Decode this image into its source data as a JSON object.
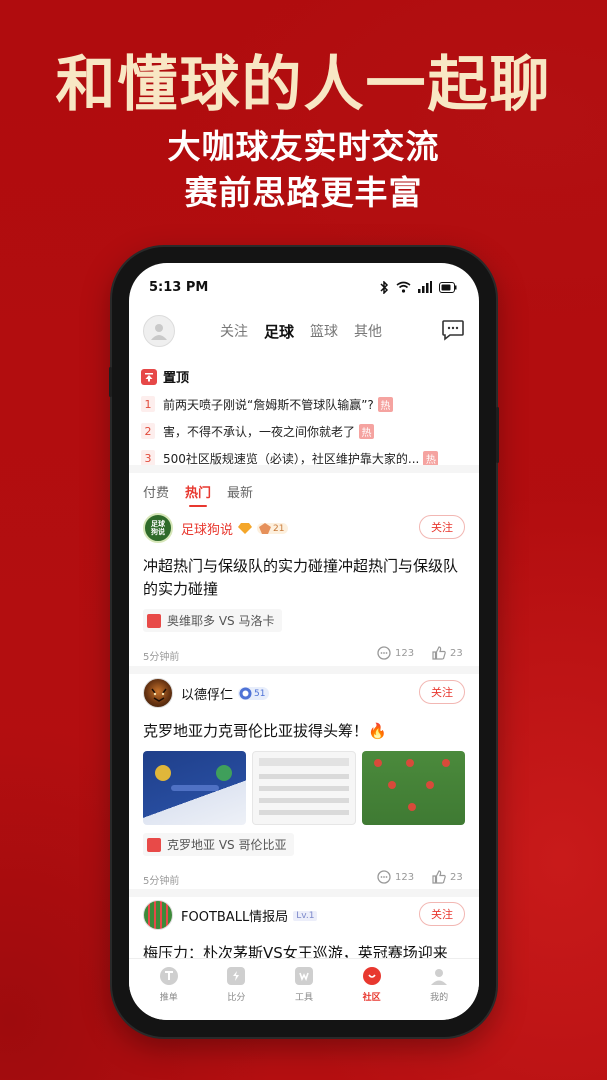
{
  "promo": {
    "headline": "和懂球的人一起聊",
    "line1": "大咖球友实时交流",
    "line2": "赛前思路更丰富"
  },
  "status": {
    "time": "5:13 PM"
  },
  "nav": {
    "tabs": [
      "关注",
      "足球",
      "篮球",
      "其他"
    ],
    "active": "足球"
  },
  "pinned": {
    "title": "置顶",
    "items": [
      {
        "num": "1",
        "text": "前两天喷子刚说“詹姆斯不管球队输赢”?",
        "tag": "热"
      },
      {
        "num": "2",
        "text": "害，不得不承认，一夜之间你就老了",
        "tag": "热"
      },
      {
        "num": "3",
        "text": "500社区版规速览（必读），社区维护靠大家的...",
        "tag": "热"
      }
    ]
  },
  "subtabs": [
    "付费",
    "热门",
    "最新"
  ],
  "posts": [
    {
      "avatar_text": "足球狗说",
      "user": "足球狗说",
      "level": "21",
      "follow": "关注",
      "text": "冲超热门与保级队的实力碰撞冲超热门与保级队的实力碰撞",
      "match": "奥维耶多 VS 马洛卡",
      "time": "5分钟前",
      "comments": "123",
      "likes": "23"
    },
    {
      "user": "以德俘仁",
      "level": "51",
      "follow": "关注",
      "text": "克罗地亚力克哥伦比亚拔得头筹！🔥",
      "match": "克罗地亚 VS 哥伦比亚",
      "time": "5分钟前",
      "comments": "123",
      "likes": "23"
    },
    {
      "user": "FOOTBALL情报局",
      "level": "Lv.1",
      "follow": "关注",
      "text": "梅压力：朴次茅斯VS女王巡游，英冠赛场迎来"
    }
  ],
  "bottom_nav": [
    {
      "label": "推单",
      "icon": "tuidan-icon"
    },
    {
      "label": "比分",
      "icon": "score-icon"
    },
    {
      "label": "工具",
      "icon": "tools-icon"
    },
    {
      "label": "社区",
      "icon": "community-icon",
      "active": true
    },
    {
      "label": "我的",
      "icon": "profile-icon"
    }
  ],
  "colors": {
    "brand_red": "#e8382f",
    "background": "#b40e10",
    "headline": "#f8e7c4"
  }
}
